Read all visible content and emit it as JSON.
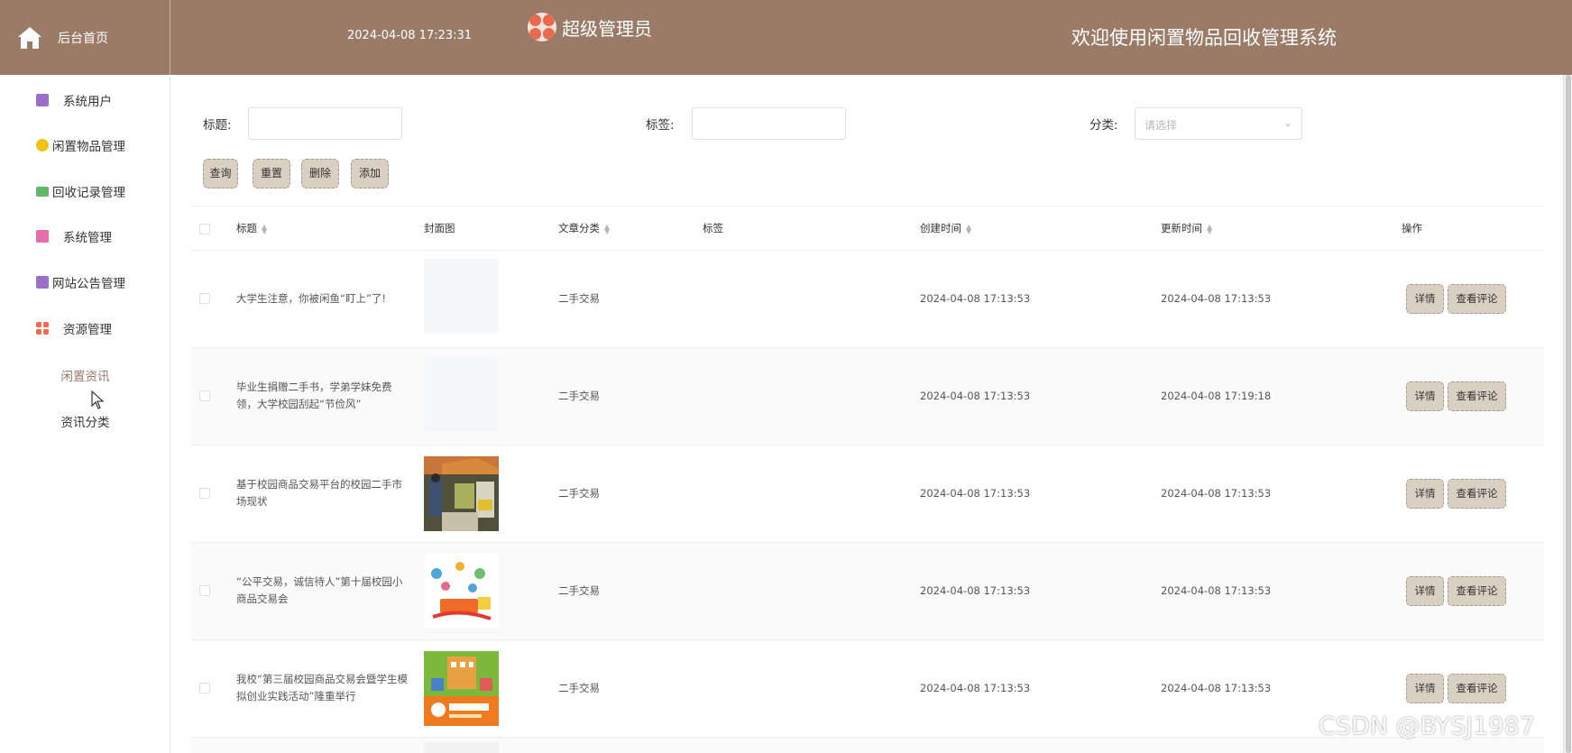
{
  "header": {
    "home_label": "后台首页",
    "datetime": "2024-04-08 17:23:31",
    "admin_name": "超级管理员",
    "system_title": "欢迎使用闲置物品回收管理系统"
  },
  "sidebar": {
    "items": [
      {
        "label": "系统用户",
        "icon": "user-box-icon",
        "color": "#9b6fc9"
      },
      {
        "label": "闲置物品管理",
        "icon": "gold-coin-icon",
        "color": "#f3c11b"
      },
      {
        "label": "回收记录管理",
        "icon": "chat-bubble-icon",
        "color": "#5fb86b"
      },
      {
        "label": "系统管理",
        "icon": "settings-doc-icon",
        "color": "#e56fa9"
      },
      {
        "label": "网站公告管理",
        "icon": "notice-box-icon",
        "color": "#9b6fc9"
      },
      {
        "label": "资源管理",
        "icon": "grid-icon",
        "color": "#ef6a50"
      }
    ],
    "subitems": [
      {
        "label": "闲置资讯",
        "active": true
      },
      {
        "label": "资讯分类",
        "active": false
      }
    ]
  },
  "filters": {
    "title_label": "标题:",
    "tag_label": "标签:",
    "category_label": "分类:",
    "category_placeholder": "请选择"
  },
  "toolbar": {
    "query": "查询",
    "reset": "重置",
    "delete": "删除",
    "add": "添加"
  },
  "table": {
    "columns": {
      "title": "标题",
      "cover": "封面图",
      "category": "文章分类",
      "tag": "标签",
      "created": "创建时间",
      "updated": "更新时间",
      "actions": "操作"
    },
    "rows": [
      {
        "title": "大学生注意，你被闲鱼“盯上”了!",
        "cover": "blank",
        "category": "二手交易",
        "tag": "",
        "created": "2024-04-08 17:13:53",
        "updated": "2024-04-08 17:13:53"
      },
      {
        "title": "毕业生捐赠二手书，学弟学妹免费领，大学校园刮起“节俭风”",
        "cover": "blank",
        "category": "二手交易",
        "tag": "",
        "created": "2024-04-08 17:13:53",
        "updated": "2024-04-08 17:19:18"
      },
      {
        "title": "基于校园商品交易平台的校园二手市场现状",
        "cover": "market-photo",
        "category": "二手交易",
        "tag": "",
        "created": "2024-04-08 17:13:53",
        "updated": "2024-04-08 17:13:53"
      },
      {
        "title": "“公平交易，诚信待人”第十届校园小商品交易会",
        "cover": "illustration",
        "category": "二手交易",
        "tag": "",
        "created": "2024-04-08 17:13:53",
        "updated": "2024-04-08 17:13:53"
      },
      {
        "title": "我校“第三届校园商品交易会暨学生模拟创业实践活动”隆重举行",
        "cover": "poster",
        "category": "二手交易",
        "tag": "",
        "created": "2024-04-08 17:13:53",
        "updated": "2024-04-08 17:13:53"
      }
    ],
    "row_actions": {
      "detail": "详情",
      "comments": "查看评论"
    }
  },
  "colors": {
    "header_bg": "#9a7b68",
    "button_bg": "#d9cfc2",
    "active_text": "#9a7b68"
  },
  "watermark": "CSDN @BYSJ1987"
}
